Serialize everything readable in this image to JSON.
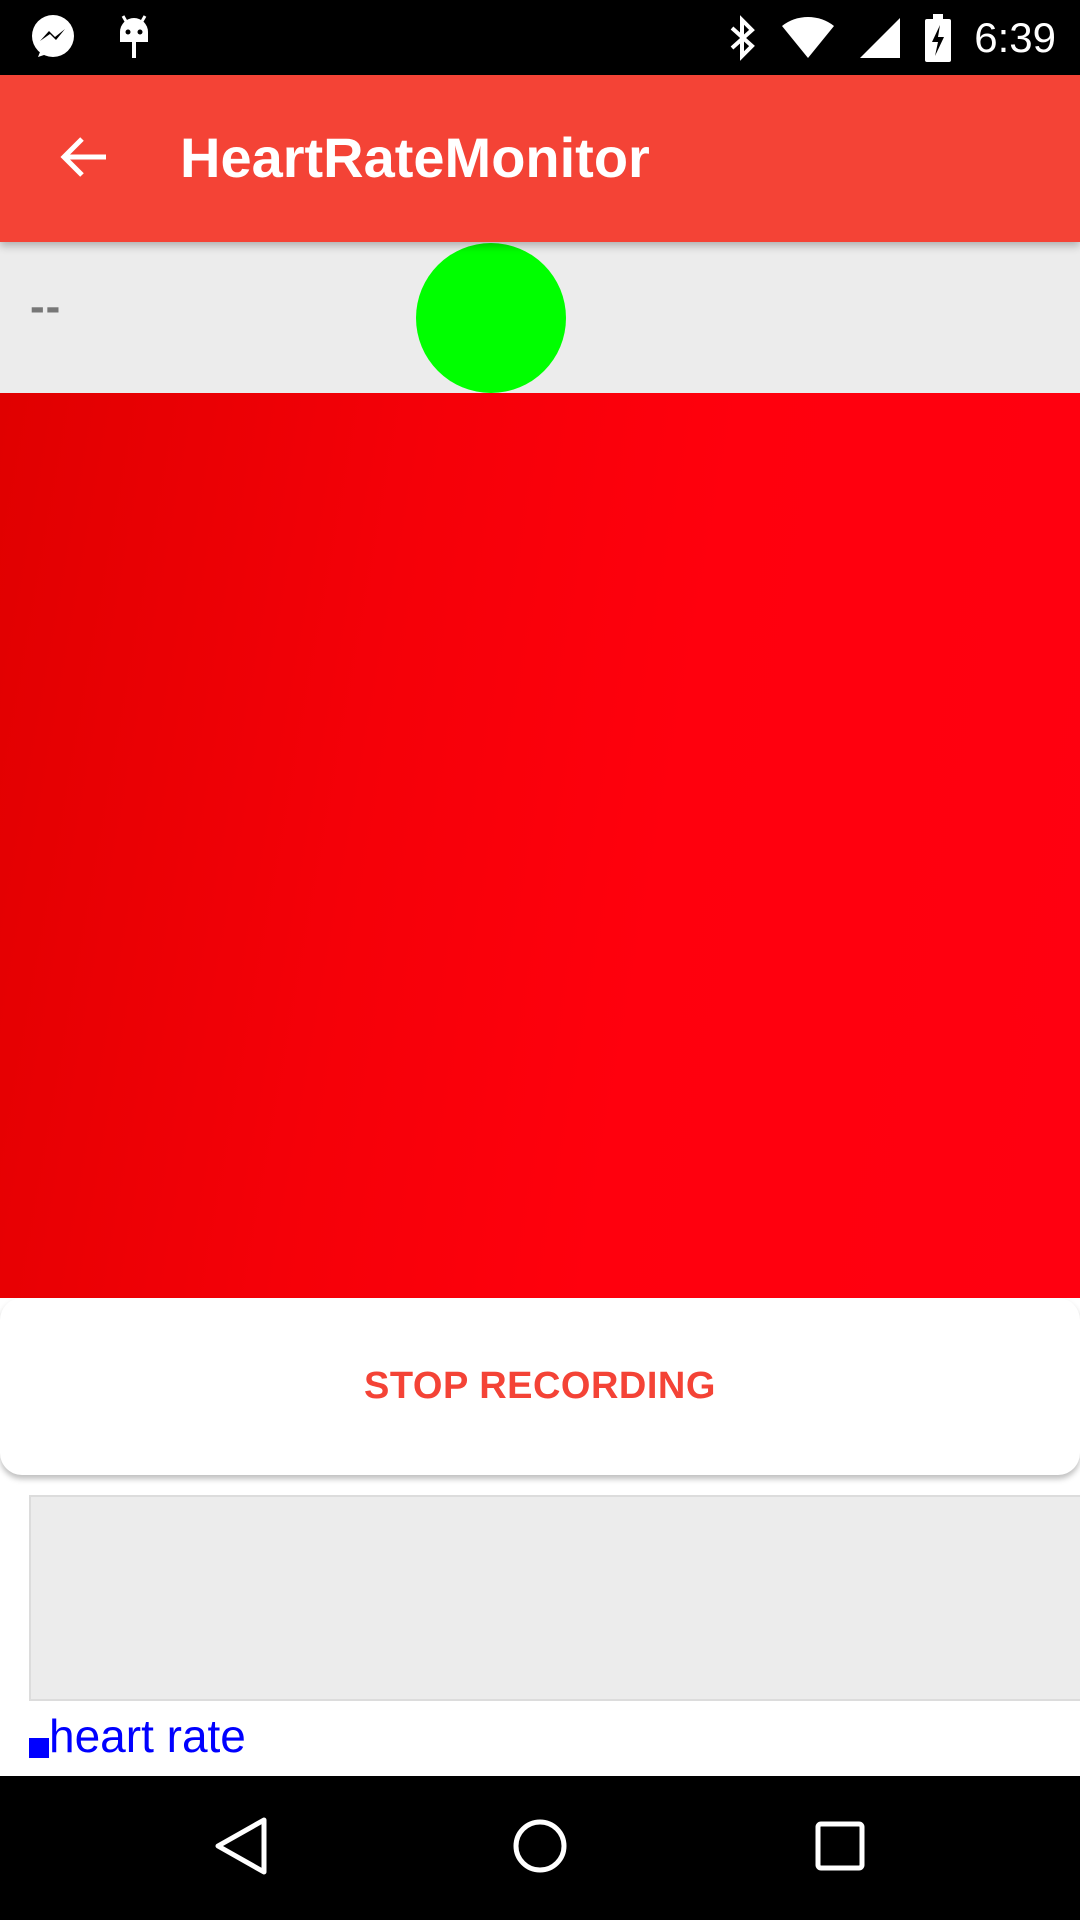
{
  "status_bar": {
    "time": "6:39",
    "left_icons": [
      "messenger-icon",
      "android-debug-icon"
    ],
    "right_icons": [
      "bluetooth-icon",
      "wifi-icon",
      "cell-signal-icon",
      "battery-charging-icon"
    ]
  },
  "app_bar": {
    "title": "HeartRateMonitor",
    "back_icon": "arrow-back-icon",
    "color": "#f44336"
  },
  "info": {
    "bpm_text": "--",
    "pulse_indicator_color": "#00ff00"
  },
  "camera_preview": {
    "color": "#ff0010"
  },
  "controls": {
    "stop_label": "STOP RECORDING"
  },
  "graph": {
    "legend_label": "heart rate",
    "series_color": "#0000ff"
  },
  "nav_bar": {
    "icons": [
      "nav-back-icon",
      "nav-home-icon",
      "nav-recents-icon"
    ]
  }
}
